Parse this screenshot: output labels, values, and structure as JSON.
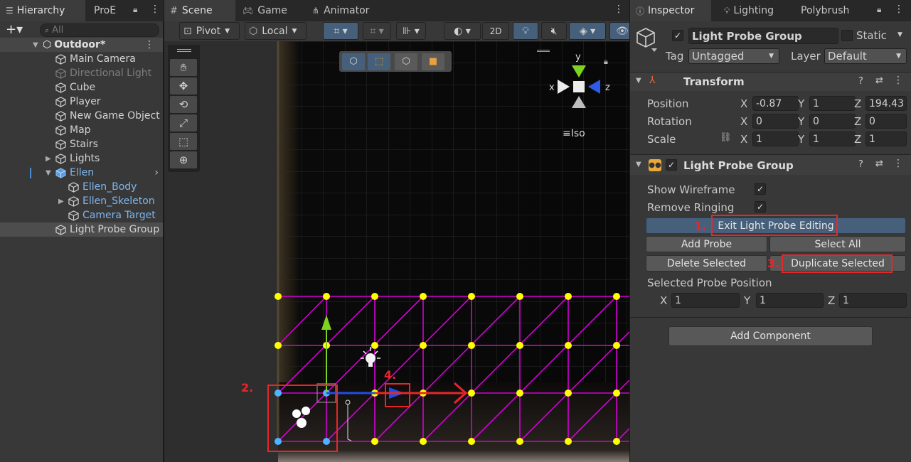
{
  "hierarchy": {
    "tab_label": "Hierarchy",
    "tab2_label": "ProE",
    "search_placeholder": "All",
    "items": [
      {
        "label": "Outdoor*"
      },
      {
        "label": "Main Camera"
      },
      {
        "label": "Directional Light"
      },
      {
        "label": "Cube"
      },
      {
        "label": "Player"
      },
      {
        "label": "New Game Object"
      },
      {
        "label": "Map"
      },
      {
        "label": "Stairs"
      },
      {
        "label": "Lights"
      },
      {
        "label": "Ellen"
      },
      {
        "label": "Ellen_Body"
      },
      {
        "label": "Ellen_Skeleton"
      },
      {
        "label": "Camera Target"
      },
      {
        "label": "Light Probe Group"
      }
    ]
  },
  "scene": {
    "tabs": [
      {
        "label": "Scene"
      },
      {
        "label": "Game"
      },
      {
        "label": "Animator"
      }
    ],
    "pivot_label": "Pivot",
    "local_label": "Local",
    "mode_2d_label": "2D",
    "iso_label": "Iso",
    "gizmo_axes": {
      "y": "y",
      "x": "x",
      "z": "z"
    }
  },
  "inspector": {
    "tabs": [
      {
        "label": "Inspector"
      },
      {
        "label": "Lighting"
      },
      {
        "label": "Polybrush"
      }
    ],
    "object_name": "Light Probe Group",
    "static_label": "Static",
    "tag_label": "Tag",
    "tag_value": "Untagged",
    "layer_label": "Layer",
    "layer_value": "Default",
    "transform": {
      "title": "Transform",
      "position_label": "Position",
      "rotation_label": "Rotation",
      "scale_label": "Scale",
      "axis_x": "X",
      "axis_y": "Y",
      "axis_z": "Z",
      "position": {
        "x": "-0.87",
        "y": "1",
        "z": "194.43"
      },
      "rotation": {
        "x": "0",
        "y": "0",
        "z": "0"
      },
      "scale": {
        "x": "1",
        "y": "1",
        "z": "1"
      }
    },
    "lpg": {
      "title": "Light Probe Group",
      "show_wireframe_label": "Show Wireframe",
      "remove_ringing_label": "Remove Ringing",
      "exit_editing_label": "Exit Light Probe Editing",
      "add_probe_label": "Add Probe",
      "select_all_label": "Select All",
      "delete_selected_label": "Delete Selected",
      "duplicate_selected_label": "Duplicate Selected",
      "selected_probe_position_label": "Selected Probe Position",
      "probe_pos": {
        "x": "1",
        "y": "1",
        "z": "1"
      }
    },
    "add_component_label": "Add Component"
  },
  "annotations": {
    "step1": "1.",
    "step2": "2.",
    "step3": "3.",
    "step4": "4."
  },
  "colors": {
    "probe_yellow": "#ffff00",
    "probe_selected": "#4fb4ff",
    "wire_magenta": "#d400d4",
    "annotation_red": "#e8262a",
    "highlight_blue": "#46607c"
  }
}
